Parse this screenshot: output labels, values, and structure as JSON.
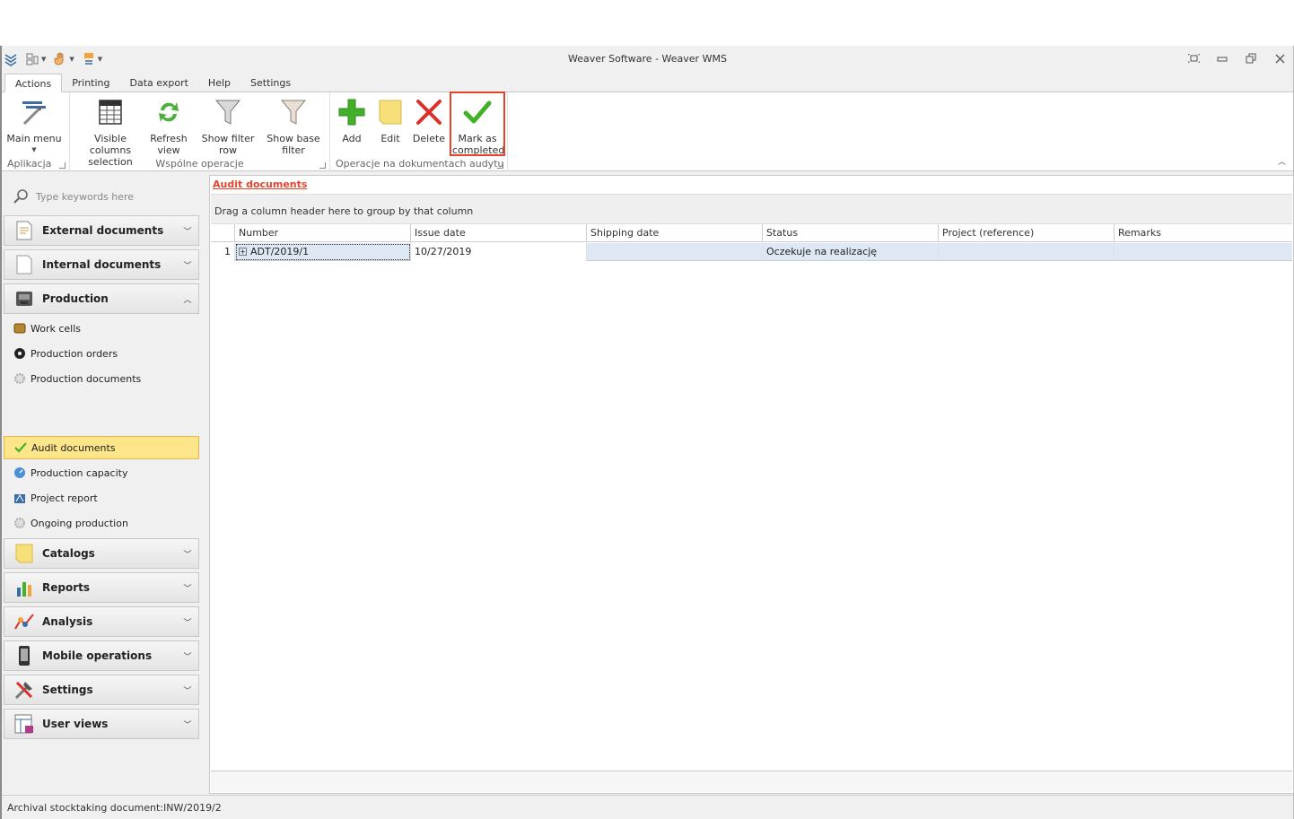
{
  "window": {
    "title": "Weaver Software - Weaver WMS"
  },
  "ribbon_tabs": [
    "Actions",
    "Printing",
    "Data export",
    "Help",
    "Settings"
  ],
  "ribbon": {
    "groups": {
      "app_label": "Aplikacja",
      "common_label": "Wspólne operacje",
      "audit_label": "Operacje na dokumentach audytu"
    },
    "buttons": {
      "main_menu": "Main menu",
      "visible_columns_1": "Visible columns",
      "visible_columns_2": "selection",
      "refresh_1": "Refresh",
      "refresh_2": "view",
      "show_filter_row": "Show filter row",
      "show_base_1": "Show base",
      "show_base_2": "filter",
      "add": "Add",
      "edit": "Edit",
      "delete": "Delete",
      "mark_1": "Mark as",
      "mark_2": "completed"
    }
  },
  "nav": {
    "search_placeholder": "Type keywords here",
    "groups_top": [
      "External documents",
      "Internal documents",
      "Production"
    ],
    "production_items": [
      "Work cells",
      "Production orders",
      "Production documents",
      "Audit documents",
      "Production capacity",
      "Project report",
      "Ongoing production"
    ],
    "groups_bottom": [
      "Catalogs",
      "Reports",
      "Analysis",
      "Mobile operations",
      "Settings",
      "User views"
    ]
  },
  "main": {
    "doc_tab": "Audit documents",
    "group_hint": "Drag a column header here to group by that column",
    "columns": [
      "Number",
      "Issue date",
      "Shipping date",
      "Status",
      "Project (reference)",
      "Remarks"
    ],
    "rows": [
      {
        "index": "1",
        "number": "ADT/2019/1",
        "issue_date": "10/27/2019",
        "shipping_date": "",
        "status": "Oczekuje na realizację",
        "project": "",
        "remarks": ""
      }
    ]
  },
  "statusbar": {
    "text": "Archival stocktaking document:INW/2019/2"
  },
  "colors": {
    "highlight": "#e8412c",
    "selected_nav": "#fde58a",
    "selected_row": "#dde8f4"
  }
}
